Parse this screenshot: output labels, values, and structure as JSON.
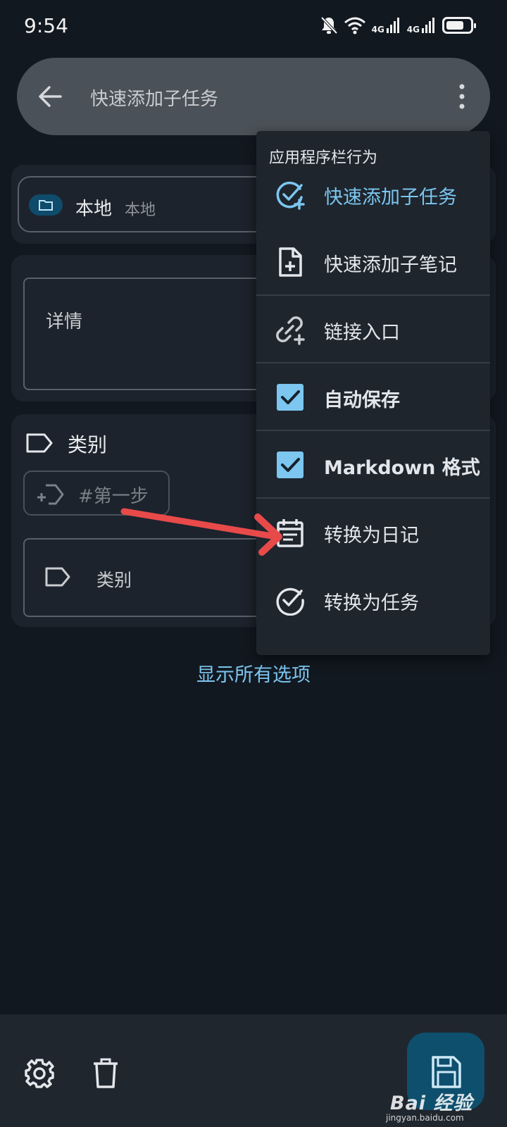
{
  "status_bar": {
    "time": "9:54",
    "network_1": "4G",
    "network_2": "4G",
    "battery_level": 0.75
  },
  "top_bar": {
    "title": "快速添加子任务",
    "back_icon": "arrow-back-icon",
    "more_icon": "more-vertical-icon"
  },
  "collection": {
    "name": "本地",
    "subtitle": "本地",
    "icon": "folder-icon"
  },
  "detail": {
    "label": "详情"
  },
  "categories": {
    "header": "类别",
    "chip_label": "#第一步",
    "field_label": "类别"
  },
  "show_all_options": "显示所有选项",
  "menu": {
    "header": "应用程序栏行为",
    "items": [
      {
        "label": "快速添加子任务",
        "icon": "add-task-icon",
        "active": true
      },
      {
        "label": "快速添加子笔记",
        "icon": "note-add-icon"
      },
      {
        "label": "链接入口",
        "icon": "add-link-icon"
      },
      {
        "label": "自动保存",
        "icon": "checkbox-checked-icon",
        "checked": true
      },
      {
        "label": "Markdown 格式",
        "icon": "checkbox-checked-icon",
        "checked": true
      },
      {
        "label": "转换为日记",
        "icon": "calendar-icon"
      },
      {
        "label": "转换为任务",
        "icon": "check-circle-icon"
      }
    ]
  },
  "watermark": {
    "brand": "Bai 经验",
    "url": "jingyan.baidu.com"
  },
  "colors": {
    "background": "#121820",
    "card": "#1c232c",
    "accent": "#7cc6f0",
    "checkbox": "#7cc6f0",
    "fab": "#0e4f6d",
    "annotation_arrow": "#e84a4a"
  }
}
